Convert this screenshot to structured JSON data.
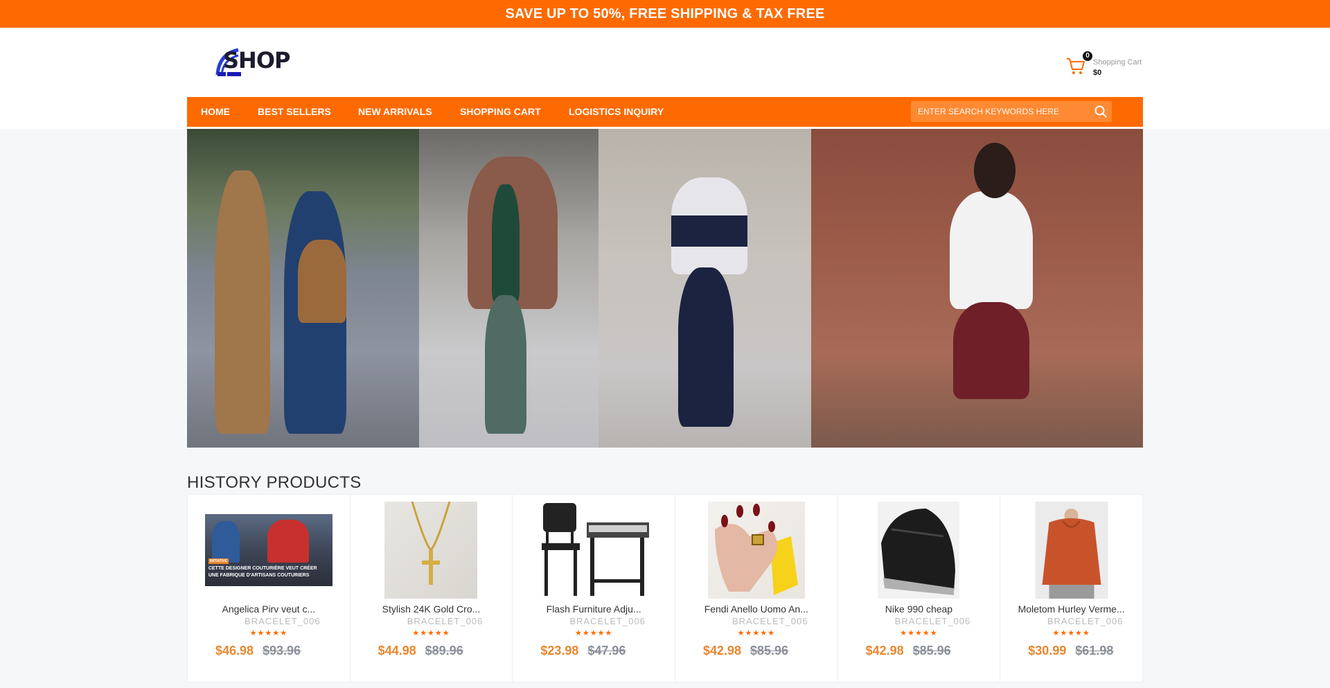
{
  "promo": {
    "text": "SAVE UP TO 50%, FREE SHIPPING & TAX FREE"
  },
  "logo": {
    "text": "SHOP"
  },
  "cart": {
    "count": "0",
    "label": "Shopping Cart",
    "total": "$0"
  },
  "nav": {
    "items": [
      "HOME",
      "BEST SELLERS",
      "NEW ARRIVALS",
      "SHOPPING CART",
      "LOGISTICS INQUIRY"
    ]
  },
  "search": {
    "placeholder": "ENTER SEARCH KEYWORDS HERE"
  },
  "section": {
    "title": "HISTORY PRODUCTS"
  },
  "products": [
    {
      "name": "Angelica Pirv veut c...",
      "sku": "BRACELET_006",
      "stars": "★★★★★",
      "price": "$46.98",
      "old_price": "$93.96"
    },
    {
      "name": "Stylish 24K Gold Cro...",
      "sku": "BRACELET_006",
      "stars": "★★★★★",
      "price": "$44.98",
      "old_price": "$89.96"
    },
    {
      "name": "Flash Furniture Adju...",
      "sku": "BRACELET_006",
      "stars": "★★★★★",
      "price": "$23.98",
      "old_price": "$47.96"
    },
    {
      "name": "Fendi Anello Uomo An...",
      "sku": "BRACELET_006",
      "stars": "★★★★★",
      "price": "$42.98",
      "old_price": "$85.96"
    },
    {
      "name": "Nike 990 cheap",
      "sku": "BRACELET_006",
      "stars": "★★★★★",
      "price": "$42.98",
      "old_price": "$85.96"
    },
    {
      "name": "Moletom Hurley Verme...",
      "sku": "BRACELET_006",
      "stars": "★★★★★",
      "price": "$30.99",
      "old_price": "$61.98"
    }
  ],
  "product_image_text": {
    "tag": "INITIATIVE",
    "caption_line1": "CETTE DESIGNER COUTURIÈRE VEUT CRÉER",
    "caption_line2": "UNE FABRIQUE D'ARTISANS COUTURIERS"
  },
  "colors": {
    "accent": "#ff6a00",
    "price": "#e8872f",
    "old_price": "#8a8f99"
  },
  "icons": {
    "cart": "shopping-cart-icon",
    "search": "search-icon"
  }
}
